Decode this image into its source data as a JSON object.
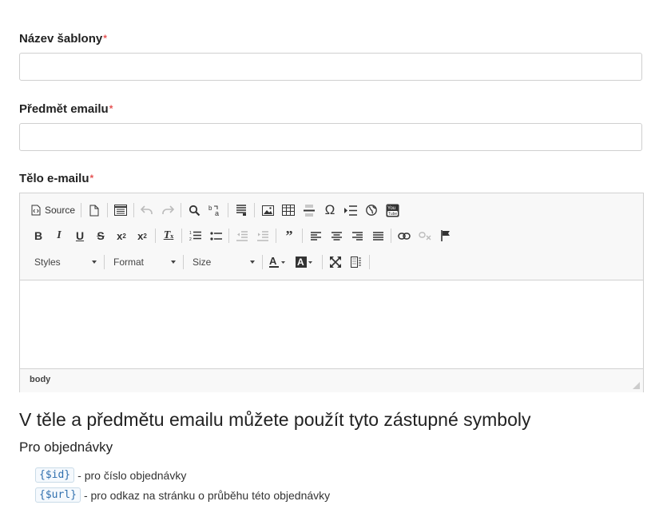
{
  "form": {
    "template_name_label": "Název šablony",
    "subject_label": "Předmět emailu",
    "body_label": "Tělo e-mailu",
    "required_marker": "*",
    "template_name_value": "",
    "subject_value": ""
  },
  "editor": {
    "toolbar": {
      "source_label": "Source",
      "styles_label": "Styles",
      "format_label": "Format",
      "size_label": "Size",
      "omega": "Ω"
    },
    "status_path": "body"
  },
  "placeholders": {
    "heading": "V těle a předmětu emailu můžete použít tyto zástupné symboly",
    "subheading": "Pro objednávky",
    "items": [
      {
        "code": "{$id}",
        "description": "- pro číslo objednávky"
      },
      {
        "code": "{$url}",
        "description": "- pro odkaz na stránku o průběhu této objednávky"
      }
    ]
  },
  "colors": {
    "required": "#e55353",
    "code_text": "#2f6fae"
  }
}
